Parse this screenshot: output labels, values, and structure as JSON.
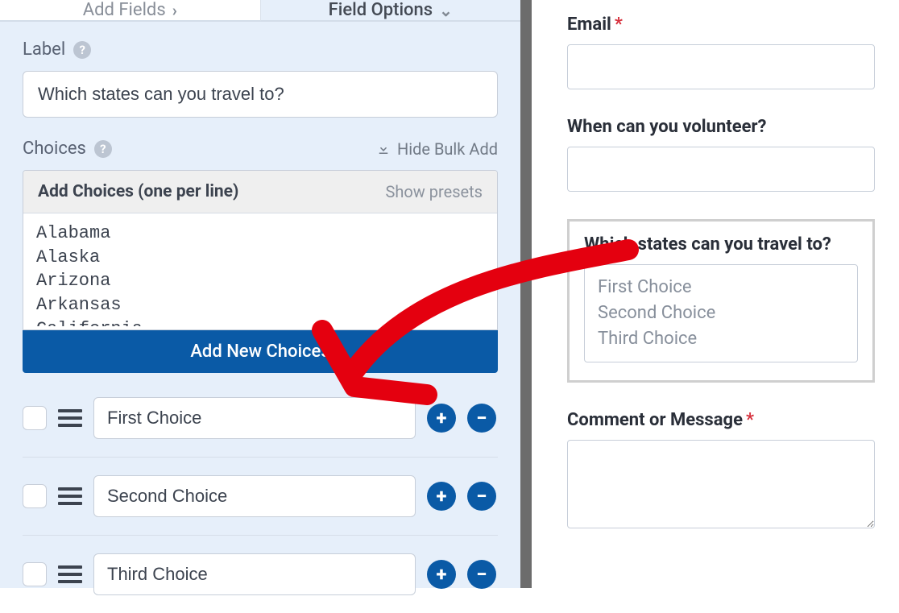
{
  "tabs": {
    "add_fields": "Add Fields",
    "field_options": "Field Options"
  },
  "label_section": {
    "title": "Label",
    "value": "Which states can you travel to?"
  },
  "choices_section": {
    "title": "Choices",
    "hide_bulk": "Hide Bulk Add",
    "bulk_head": "Add Choices (one per line)",
    "show_presets": "Show presets",
    "bulk_lines": "Alabama\nAlaska\nArizona\nArkansas\nCalifornia",
    "add_new": "Add New Choices",
    "rows": [
      {
        "value": "First Choice"
      },
      {
        "value": "Second Choice"
      },
      {
        "value": "Third Choice"
      }
    ]
  },
  "preview": {
    "email_label": "Email",
    "volunteer_label": "When can you volunteer?",
    "states_label": "Which states can you travel to?",
    "states_options": [
      "First Choice",
      "Second Choice",
      "Third Choice"
    ],
    "comment_label": "Comment or Message"
  }
}
